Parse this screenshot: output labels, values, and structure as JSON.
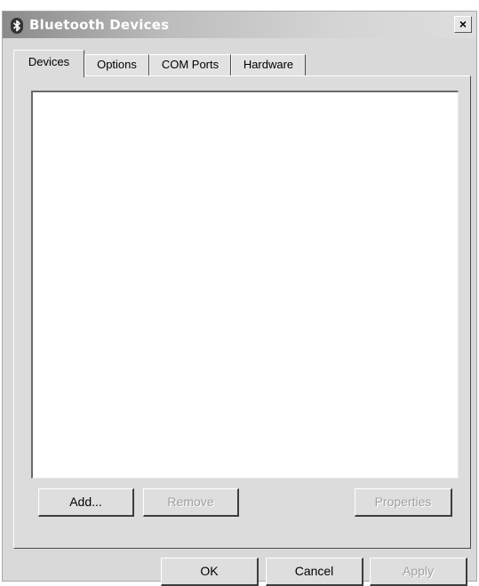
{
  "window": {
    "title": "Bluetooth Devices",
    "close_glyph": "×"
  },
  "tabs": [
    {
      "label": "Devices",
      "active": true
    },
    {
      "label": "Options",
      "active": false
    },
    {
      "label": "COM Ports",
      "active": false
    },
    {
      "label": "Hardware",
      "active": false
    }
  ],
  "device_list": {
    "items": []
  },
  "panel_buttons": {
    "add": "Add...",
    "remove": "Remove",
    "properties": "Properties"
  },
  "dialog_buttons": {
    "ok": "OK",
    "cancel": "Cancel",
    "apply": "Apply"
  },
  "icons": {
    "title_icon": "bluetooth-icon",
    "close": "close-icon"
  }
}
